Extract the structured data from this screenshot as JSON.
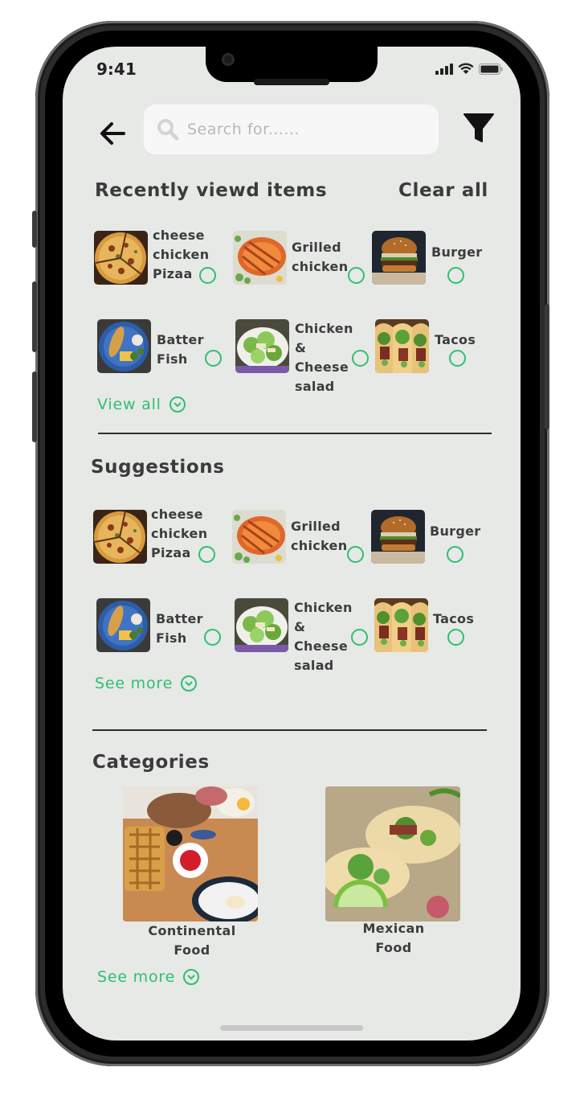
{
  "status": {
    "time": "9:41"
  },
  "search": {
    "placeholder": "Search for......"
  },
  "recent": {
    "title": "Recently viewd items",
    "clear_label": "Clear all",
    "items": [
      {
        "label": "cheese\nchicken\nPizaa"
      },
      {
        "label": "Grilled\nchicken"
      },
      {
        "label": "Burger"
      },
      {
        "label": "Batter\nFish"
      },
      {
        "label": "Chicken &\nCheese\nsalad"
      },
      {
        "label": "Tacos"
      }
    ],
    "view_all_label": "View all"
  },
  "suggestions": {
    "title": "Suggestions",
    "items": [
      {
        "label": "cheese\nchicken\nPizaa"
      },
      {
        "label": "Grilled\nchicken"
      },
      {
        "label": "Burger"
      },
      {
        "label": "Batter\nFish"
      },
      {
        "label": "Chicken &\nCheese\nsalad"
      },
      {
        "label": "Tacos"
      }
    ],
    "see_more_label": "See more"
  },
  "categories": {
    "title": "Categories",
    "items": [
      {
        "label": "Continental\nFood"
      },
      {
        "label": "Mexican\nFood"
      }
    ],
    "see_more_label": "See more"
  },
  "colors": {
    "accent": "#2fbf71",
    "background": "#e6e9e6",
    "text": "#3b3b3b"
  },
  "icons": [
    "back-arrow-icon",
    "search-icon",
    "filter-icon",
    "chevron-down-icon",
    "signal-icon",
    "wifi-icon",
    "battery-icon"
  ]
}
